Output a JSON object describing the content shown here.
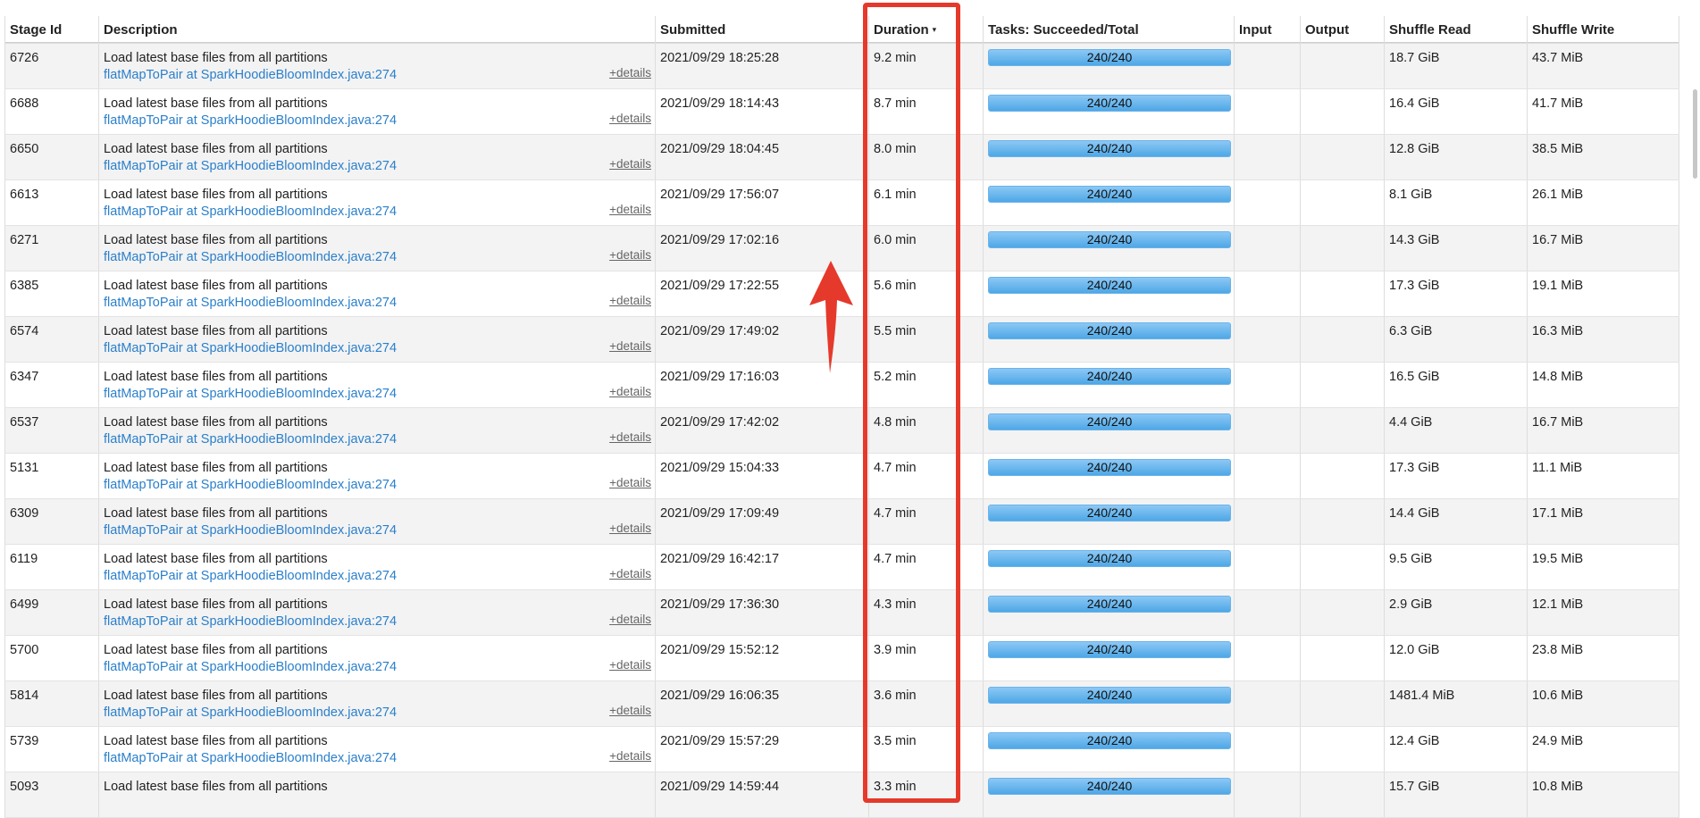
{
  "table": {
    "columns": {
      "stage_id": "Stage Id",
      "description": "Description",
      "submitted": "Submitted",
      "duration": "Duration",
      "duration_sort_glyph": "▾",
      "tasks": "Tasks: Succeeded/Total",
      "input": "Input",
      "output": "Output",
      "shuffle_read": "Shuffle Read",
      "shuffle_write": "Shuffle Write"
    },
    "details_label": "+details",
    "rows": [
      {
        "stage_id": "6726",
        "name": "Load latest base files from all partitions",
        "callsite": "flatMapToPair at SparkHoodieBloomIndex.java:274",
        "submitted": "2021/09/29 18:25:28",
        "duration": "9.2 min",
        "tasks": "240/240",
        "progress": 1.0,
        "input": "",
        "output": "",
        "shuffle_read": "18.7 GiB",
        "shuffle_write": "43.7 MiB"
      },
      {
        "stage_id": "6688",
        "name": "Load latest base files from all partitions",
        "callsite": "flatMapToPair at SparkHoodieBloomIndex.java:274",
        "submitted": "2021/09/29 18:14:43",
        "duration": "8.7 min",
        "tasks": "240/240",
        "progress": 1.0,
        "input": "",
        "output": "",
        "shuffle_read": "16.4 GiB",
        "shuffle_write": "41.7 MiB"
      },
      {
        "stage_id": "6650",
        "name": "Load latest base files from all partitions",
        "callsite": "flatMapToPair at SparkHoodieBloomIndex.java:274",
        "submitted": "2021/09/29 18:04:45",
        "duration": "8.0 min",
        "tasks": "240/240",
        "progress": 1.0,
        "input": "",
        "output": "",
        "shuffle_read": "12.8 GiB",
        "shuffle_write": "38.5 MiB"
      },
      {
        "stage_id": "6613",
        "name": "Load latest base files from all partitions",
        "callsite": "flatMapToPair at SparkHoodieBloomIndex.java:274",
        "submitted": "2021/09/29 17:56:07",
        "duration": "6.1 min",
        "tasks": "240/240",
        "progress": 1.0,
        "input": "",
        "output": "",
        "shuffle_read": "8.1 GiB",
        "shuffle_write": "26.1 MiB"
      },
      {
        "stage_id": "6271",
        "name": "Load latest base files from all partitions",
        "callsite": "flatMapToPair at SparkHoodieBloomIndex.java:274",
        "submitted": "2021/09/29 17:02:16",
        "duration": "6.0 min",
        "tasks": "240/240",
        "progress": 1.0,
        "input": "",
        "output": "",
        "shuffle_read": "14.3 GiB",
        "shuffle_write": "16.7 MiB"
      },
      {
        "stage_id": "6385",
        "name": "Load latest base files from all partitions",
        "callsite": "flatMapToPair at SparkHoodieBloomIndex.java:274",
        "submitted": "2021/09/29 17:22:55",
        "duration": "5.6 min",
        "tasks": "240/240",
        "progress": 1.0,
        "input": "",
        "output": "",
        "shuffle_read": "17.3 GiB",
        "shuffle_write": "19.1 MiB"
      },
      {
        "stage_id": "6574",
        "name": "Load latest base files from all partitions",
        "callsite": "flatMapToPair at SparkHoodieBloomIndex.java:274",
        "submitted": "2021/09/29 17:49:02",
        "duration": "5.5 min",
        "tasks": "240/240",
        "progress": 1.0,
        "input": "",
        "output": "",
        "shuffle_read": "6.3 GiB",
        "shuffle_write": "16.3 MiB"
      },
      {
        "stage_id": "6347",
        "name": "Load latest base files from all partitions",
        "callsite": "flatMapToPair at SparkHoodieBloomIndex.java:274",
        "submitted": "2021/09/29 17:16:03",
        "duration": "5.2 min",
        "tasks": "240/240",
        "progress": 1.0,
        "input": "",
        "output": "",
        "shuffle_read": "16.5 GiB",
        "shuffle_write": "14.8 MiB"
      },
      {
        "stage_id": "6537",
        "name": "Load latest base files from all partitions",
        "callsite": "flatMapToPair at SparkHoodieBloomIndex.java:274",
        "submitted": "2021/09/29 17:42:02",
        "duration": "4.8 min",
        "tasks": "240/240",
        "progress": 1.0,
        "input": "",
        "output": "",
        "shuffle_read": "4.4 GiB",
        "shuffle_write": "16.7 MiB"
      },
      {
        "stage_id": "5131",
        "name": "Load latest base files from all partitions",
        "callsite": "flatMapToPair at SparkHoodieBloomIndex.java:274",
        "submitted": "2021/09/29 15:04:33",
        "duration": "4.7 min",
        "tasks": "240/240",
        "progress": 1.0,
        "input": "",
        "output": "",
        "shuffle_read": "17.3 GiB",
        "shuffle_write": "11.1 MiB"
      },
      {
        "stage_id": "6309",
        "name": "Load latest base files from all partitions",
        "callsite": "flatMapToPair at SparkHoodieBloomIndex.java:274",
        "submitted": "2021/09/29 17:09:49",
        "duration": "4.7 min",
        "tasks": "240/240",
        "progress": 1.0,
        "input": "",
        "output": "",
        "shuffle_read": "14.4 GiB",
        "shuffle_write": "17.1 MiB"
      },
      {
        "stage_id": "6119",
        "name": "Load latest base files from all partitions",
        "callsite": "flatMapToPair at SparkHoodieBloomIndex.java:274",
        "submitted": "2021/09/29 16:42:17",
        "duration": "4.7 min",
        "tasks": "240/240",
        "progress": 1.0,
        "input": "",
        "output": "",
        "shuffle_read": "9.5 GiB",
        "shuffle_write": "19.5 MiB"
      },
      {
        "stage_id": "6499",
        "name": "Load latest base files from all partitions",
        "callsite": "flatMapToPair at SparkHoodieBloomIndex.java:274",
        "submitted": "2021/09/29 17:36:30",
        "duration": "4.3 min",
        "tasks": "240/240",
        "progress": 1.0,
        "input": "",
        "output": "",
        "shuffle_read": "2.9 GiB",
        "shuffle_write": "12.1 MiB"
      },
      {
        "stage_id": "5700",
        "name": "Load latest base files from all partitions",
        "callsite": "flatMapToPair at SparkHoodieBloomIndex.java:274",
        "submitted": "2021/09/29 15:52:12",
        "duration": "3.9 min",
        "tasks": "240/240",
        "progress": 1.0,
        "input": "",
        "output": "",
        "shuffle_read": "12.0 GiB",
        "shuffle_write": "23.8 MiB"
      },
      {
        "stage_id": "5814",
        "name": "Load latest base files from all partitions",
        "callsite": "flatMapToPair at SparkHoodieBloomIndex.java:274",
        "submitted": "2021/09/29 16:06:35",
        "duration": "3.6 min",
        "tasks": "240/240",
        "progress": 1.0,
        "input": "",
        "output": "",
        "shuffle_read": "1481.4 MiB",
        "shuffle_write": "10.6 MiB"
      },
      {
        "stage_id": "5739",
        "name": "Load latest base files from all partitions",
        "callsite": "flatMapToPair at SparkHoodieBloomIndex.java:274",
        "submitted": "2021/09/29 15:57:29",
        "duration": "3.5 min",
        "tasks": "240/240",
        "progress": 1.0,
        "input": "",
        "output": "",
        "shuffle_read": "12.4 GiB",
        "shuffle_write": "24.9 MiB"
      },
      {
        "stage_id": "5093",
        "name": "Load latest base files from all partitions",
        "callsite": "",
        "submitted": "2021/09/29 14:59:44",
        "duration": "3.3 min",
        "tasks": "240/240",
        "progress": 1.0,
        "input": "",
        "output": "",
        "shuffle_read": "15.7 GiB",
        "shuffle_write": "10.8 MiB"
      }
    ]
  },
  "annotations": {
    "highlight_color": "#e5392b",
    "progress_color": "#4ea7e6",
    "link_color": "#2a7fcb",
    "arrow_icon": "up-arrow-icon"
  }
}
